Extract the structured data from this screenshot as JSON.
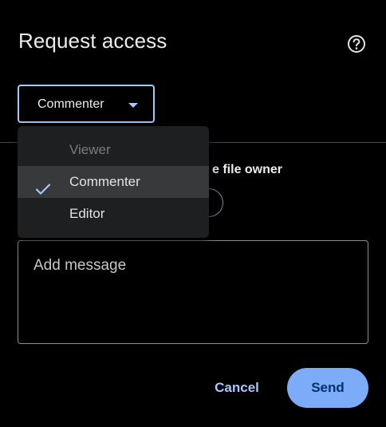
{
  "dialog": {
    "title": "Request access"
  },
  "icons": {
    "help": "help-circle-icon",
    "dropdown": "caret-down-icon",
    "check": "check-icon"
  },
  "role_select": {
    "value": "Commenter"
  },
  "role_menu": {
    "items": [
      {
        "label": "Viewer",
        "disabled": true,
        "selected": false
      },
      {
        "label": "Commenter",
        "disabled": false,
        "selected": true
      },
      {
        "label": "Editor",
        "disabled": false,
        "selected": false
      }
    ]
  },
  "notify": {
    "visible_label": "e file owner"
  },
  "message": {
    "placeholder": "Add message",
    "value": ""
  },
  "actions": {
    "cancel_label": "Cancel",
    "send_label": "Send"
  },
  "colors": {
    "background": "#000000",
    "accent": "#a8c7fa",
    "send_button": "#7cacf8",
    "menu_background": "#1e1f20",
    "menu_selected": "#37393b"
  }
}
